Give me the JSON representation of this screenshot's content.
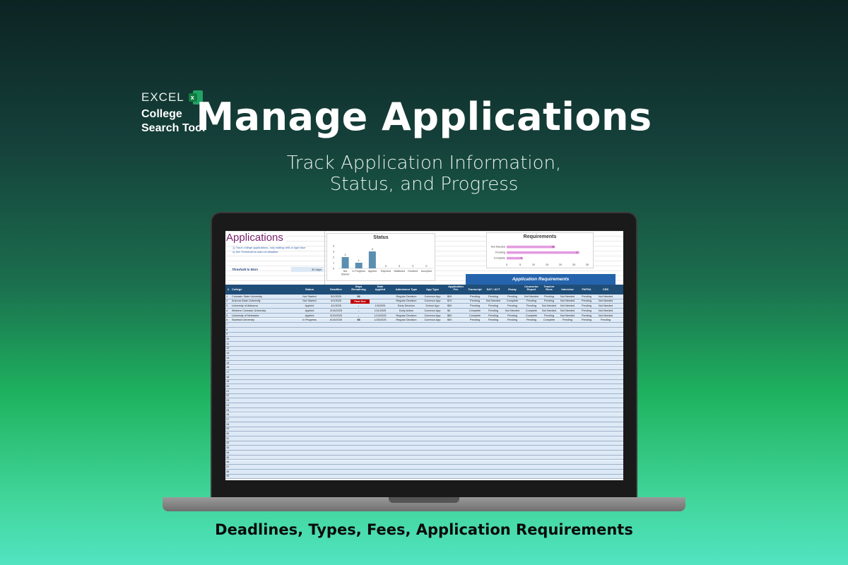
{
  "brand": {
    "excel": "EXCEL",
    "excel_icon": "excel-logo-icon",
    "line1": "College",
    "line2": "Search Tool"
  },
  "title": "Manage Applications",
  "subtitle_line1": "Track Application Information,",
  "subtitle_line2": "Status, and Progress",
  "footer": "Deadlines, Types, Fees, Application Requirements",
  "sheet": {
    "title": "Applications",
    "note1": "1) Track college applications, only editing cells in light blue",
    "note2": "2) Set Threshold to warn of deadline",
    "threshold_label": "Threshold to Warn",
    "threshold_value": "30 days",
    "requirements_band": "Application Requirements",
    "columns": {
      "num": "#",
      "college": "College",
      "status": "Status",
      "deadline": "Deadline",
      "days_top": "Days",
      "days_bottom": "Remaining",
      "date_top": "Date",
      "date_bottom": "Applied",
      "admission": "Admission Type",
      "apptype": "App Type",
      "fee_top": "Application",
      "fee_bottom": "Fee",
      "transcript": "Transcript",
      "sat": "SAT / ACT",
      "essay": "Essay",
      "counselor_top": "Counselor",
      "counselor_bottom": "Report",
      "teacher_top": "Teacher",
      "teacher_bottom": "Recs",
      "interview": "Interview",
      "fafsa": "FAFSA",
      "css": "CSS"
    },
    "rows": [
      {
        "num": "1",
        "college": "Colorado State University",
        "status": "Not Started",
        "deadline": "5/1/2025",
        "days": "58",
        "applied": "",
        "admission": "Regular Decision",
        "apptype": "Common App",
        "fee": "$90",
        "transcript": "Pending",
        "sat": "Pending",
        "essay": "Pending",
        "counselor": "Not Needed",
        "teacher": "Pending",
        "interview": "Not Needed",
        "fafsa": "Pending",
        "css": "Not Needed"
      },
      {
        "num": "2",
        "college": "Arizona State University",
        "status": "Not Started",
        "deadline": "4/1/2025",
        "days": "Past Due",
        "applied": "",
        "admission": "Regular Decision",
        "apptype": "Common App",
        "fee": "$70",
        "transcript": "Pending",
        "sat": "Not Needed",
        "essay": "Complete",
        "counselor": "Pending",
        "teacher": "Pending",
        "interview": "Not Needed",
        "fafsa": "Pending",
        "css": "Not Needed"
      },
      {
        "num": "3",
        "college": "University of Alabama",
        "status": "Applied",
        "deadline": "4/1/2025",
        "days": "-",
        "applied": "1/5/2025",
        "admission": "Early Decision",
        "apptype": "School App",
        "fee": "$50",
        "transcript": "Pending",
        "sat": "Pending",
        "essay": "Pending",
        "counselor": "Pending",
        "teacher": "Not Needed",
        "interview": "Not Needed",
        "fafsa": "Pending",
        "css": "Not Needed"
      },
      {
        "num": "4",
        "college": "Western Colorado University",
        "status": "Applied",
        "deadline": "3/15/2025",
        "days": "-",
        "applied": "1/11/2025",
        "admission": "Early Action",
        "apptype": "Common App",
        "fee": "$0",
        "transcript": "Complete",
        "sat": "Pending",
        "essay": "Not Needed",
        "counselor": "Complete",
        "teacher": "Not Needed",
        "interview": "Not Needed",
        "fafsa": "Pending",
        "css": "Not Needed"
      },
      {
        "num": "5",
        "college": "University of Nebraska",
        "status": "Applied",
        "deadline": "3/10/2025",
        "days": "-",
        "applied": "1/13/2025",
        "admission": "Regular Decision",
        "apptype": "Common App",
        "fee": "$60",
        "transcript": "Complete",
        "sat": "Pending",
        "essay": "Pending",
        "counselor": "Complete",
        "teacher": "Pending",
        "interview": "Not Needed",
        "fafsa": "Pending",
        "css": "Not Needed"
      },
      {
        "num": "6",
        "college": "Stanford University",
        "status": "In Progress",
        "deadline": "6/15/2025",
        "days": "58",
        "applied": "1/25/2025",
        "admission": "Regular Decision",
        "apptype": "Common App",
        "fee": "$90",
        "transcript": "Pending",
        "sat": "Pending",
        "essay": "Pending",
        "counselor": "Pending",
        "teacher": "Complete",
        "interview": "Pending",
        "fafsa": "Pending",
        "css": "Pending"
      }
    ],
    "empty_row_numbers": [
      "7",
      "8",
      "9",
      "10",
      "11",
      "12",
      "13",
      "14",
      "15",
      "16",
      "17",
      "18",
      "19",
      "20",
      "21",
      "22",
      "23",
      "24",
      "25",
      "26",
      "27",
      "28",
      "29",
      "30",
      "31",
      "32",
      "33",
      "34",
      "35",
      "36",
      "37",
      "38",
      "39"
    ]
  },
  "chart_data": [
    {
      "type": "bar",
      "title": "Status",
      "categories": [
        "Not Started",
        "In Progress",
        "Applied",
        "Rejected",
        "Waitlisted",
        "Declined",
        "Accepted"
      ],
      "values": [
        2,
        1,
        3,
        0,
        0,
        0,
        0
      ],
      "ylim": [
        0,
        4
      ],
      "yticks": [
        "0",
        "1",
        "2",
        "3",
        "4"
      ],
      "bar_color": "#5b8fb0"
    },
    {
      "type": "bar",
      "orientation": "horizontal",
      "title": "Requirements",
      "categories": [
        "Not Needed",
        "Pending",
        "Complete"
      ],
      "values": [
        18,
        27,
        6
      ],
      "xlim": [
        0,
        30
      ],
      "xticks": [
        "0",
        "5",
        "10",
        "15",
        "20",
        "25",
        "30"
      ],
      "bar_color": "#e39be0"
    }
  ]
}
